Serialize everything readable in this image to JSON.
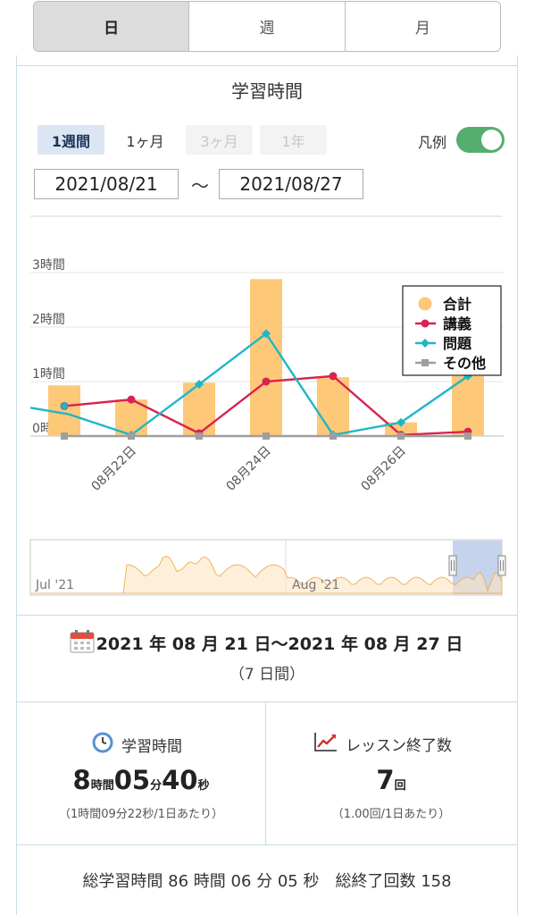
{
  "tabs": [
    {
      "label": "日",
      "active": true
    },
    {
      "label": "週",
      "active": false
    },
    {
      "label": "月",
      "active": false
    }
  ],
  "panel_title": "学習時間",
  "range_buttons": [
    {
      "label": "1週間",
      "state": "active"
    },
    {
      "label": "1ヶ月",
      "state": "normal"
    },
    {
      "label": "3ヶ月",
      "state": "disabled"
    },
    {
      "label": "1年",
      "state": "disabled"
    }
  ],
  "legend_toggle": {
    "label": "凡例",
    "on": true,
    "color": "#55ad6f"
  },
  "date_range": {
    "start": "2021/08/21",
    "separator": "〜",
    "end": "2021/08/27"
  },
  "chart_data": {
    "type": "bar",
    "y_axis": {
      "ticks": [
        "0時間",
        "1時間",
        "2時間",
        "3時間"
      ],
      "ylim": [
        0,
        3
      ]
    },
    "x_tick_labels": [
      "08月22日",
      "08月24日",
      "08月26日"
    ],
    "categories": [
      "08/21",
      "08/22",
      "08/23",
      "08/24",
      "08/25",
      "08/26",
      "08/27"
    ],
    "legend_position": "top-right",
    "series": [
      {
        "name": "合計",
        "kind": "bar",
        "color": "#fdc878",
        "values": [
          0.93,
          0.67,
          0.98,
          2.88,
          1.08,
          0.25,
          1.1
        ]
      },
      {
        "name": "講義",
        "kind": "line",
        "color": "#d8234f",
        "values": [
          0.55,
          0.67,
          0.05,
          1.0,
          1.1,
          0.02,
          0.08
        ]
      },
      {
        "name": "問題",
        "kind": "line",
        "color": "#1fb6c7",
        "values": [
          0.55,
          0.02,
          0.95,
          1.88,
          0.02,
          0.25,
          1.1
        ]
      },
      {
        "name": "その他",
        "kind": "line",
        "color": "#9e9e9e",
        "values": [
          0,
          0,
          0,
          0,
          0,
          0,
          0
        ]
      }
    ],
    "navigator": {
      "labels": [
        "Jul '21",
        "Aug '21"
      ]
    }
  },
  "summary": {
    "date_range_text": "2021 年 08 月 21 日〜2021 年 08 月 27 日",
    "days_text": "（7 日間）"
  },
  "stats": {
    "study_time": {
      "title": "学習時間",
      "hours": "8",
      "hours_unit": "時間",
      "minutes": "05",
      "minutes_unit": "分",
      "seconds": "40",
      "seconds_unit": "秒",
      "sub": "（1時間09分22秒/1日あたり）"
    },
    "lessons": {
      "title": "レッスン終了数",
      "count": "7",
      "count_unit": "回",
      "sub": "（1.00回/1日あたり）"
    }
  },
  "totals": {
    "text": "総学習時間 86 時間 06 分 05 秒　総終了回数 158"
  }
}
